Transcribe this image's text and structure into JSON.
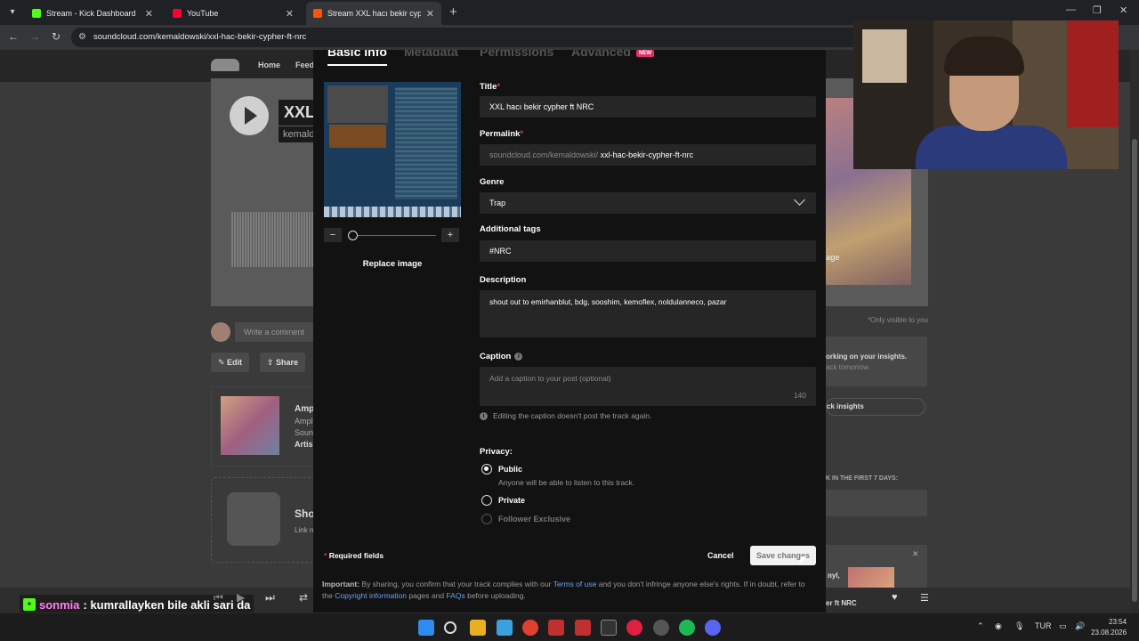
{
  "browser": {
    "tabs": [
      {
        "label": "Stream - Kick Dashboard",
        "color": "#53fc18"
      },
      {
        "label": "YouTube",
        "color": "#ff0033"
      },
      {
        "label": "Stream XXL hacı bekir cypher ft",
        "color": "#ff5500"
      }
    ],
    "url": "soundcloud.com/kemaldowski/xxl-hac-bekir-cypher-ft-nrc"
  },
  "soundcloud_bg": {
    "nav": [
      "Home",
      "Feed"
    ],
    "hero_title": "XXL",
    "hero_sub": "kemald",
    "comment_placeholder": "Write a comment",
    "edit_label": "Edit",
    "share_label": "Share",
    "only_visible": "*Only visible to you",
    "insights_title": "orking on your insights.",
    "insights_sub": "ack tomorrow.",
    "insights_btn": "ck insights",
    "first7": "K IN THE FIRST 7 DAYS:",
    "cover_label": "age",
    "amp_title": "Amp",
    "amp_lines": [
      "Ampl",
      "Soun",
      "Artis"
    ],
    "show_title": "Sho",
    "show_sub": "Link n",
    "mini_title": "er ft NRC",
    "mini_title2": "nyl,"
  },
  "modal": {
    "tabs": [
      "Basic info",
      "Metadata",
      "Permissions",
      "Advanced"
    ],
    "new_badge": "NEW",
    "replace_image": "Replace image",
    "zoom_minus": "−",
    "zoom_plus": "+",
    "title_label": "Title",
    "title_value": "XXL hacı bekir cypher ft NRC",
    "permalink_label": "Permalink",
    "permalink_prefix": "soundcloud.com/kemaldowski/",
    "permalink_value": "xxl-hac-bekir-cypher-ft-nrc",
    "genre_label": "Genre",
    "genre_value": "Trap",
    "tags_label": "Additional tags",
    "tags_value": "#NRC",
    "description_label": "Description",
    "description_value": "shout out to emirhanblut, bdg, sooshim, kemoflex, noldulanneco, pazar",
    "caption_label": "Caption",
    "caption_placeholder": "Add a caption to your post (optional)",
    "caption_count": "140",
    "caption_note": "Editing the caption doesn't post the track again.",
    "privacy_label": "Privacy:",
    "privacy_public": "Public",
    "privacy_public_sub": "Anyone will be able to listen to this track.",
    "privacy_private": "Private",
    "privacy_follower": "Follower Exclusive",
    "required_fields": "Required fields",
    "cancel": "Cancel",
    "save": "Save changes",
    "important_lead": "Important:",
    "important_text1": "By sharing, you confirm that your track complies with our",
    "terms_link": "Terms of use",
    "important_text2": "and you don't infringe anyone else's rights. If in doubt, refer to the",
    "copyright_link": "Copyright information",
    "important_text3": "pages and",
    "faqs_link": "FAQs",
    "important_text4": "before uploading."
  },
  "chat": {
    "user": "sonmia",
    "message": ": kumrallayken bile akli sari da"
  },
  "taskbar": {
    "lang": "TUR",
    "time": "23:54",
    "date": "23.08.2026"
  }
}
